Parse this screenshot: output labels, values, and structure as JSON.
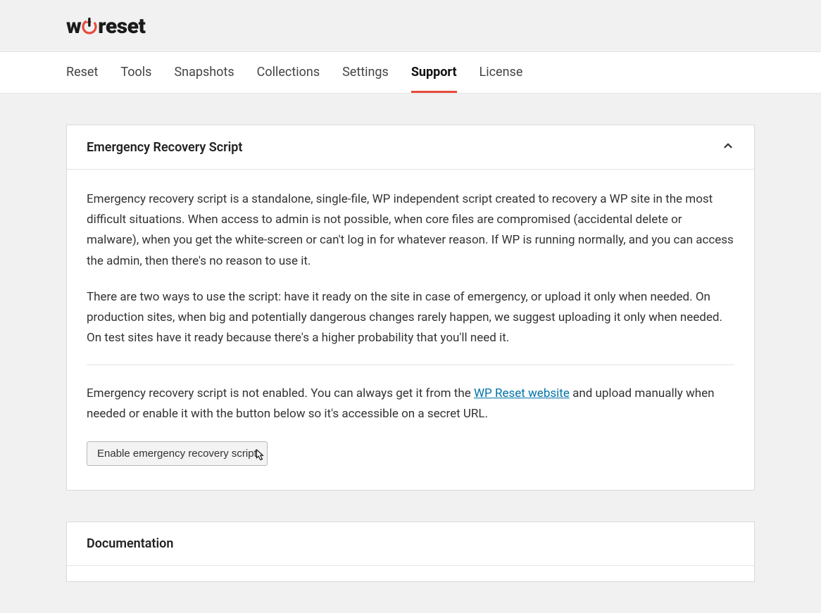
{
  "brand": {
    "prefix": "w",
    "accent": "p",
    "suffix": "reset"
  },
  "tabs": [
    {
      "label": "Reset",
      "active": false
    },
    {
      "label": "Tools",
      "active": false
    },
    {
      "label": "Snapshots",
      "active": false
    },
    {
      "label": "Collections",
      "active": false
    },
    {
      "label": "Settings",
      "active": false
    },
    {
      "label": "Support",
      "active": true
    },
    {
      "label": "License",
      "active": false
    }
  ],
  "panel1": {
    "title": "Emergency Recovery Script",
    "para1": "Emergency recovery script is a standalone, single-file, WP independent script created to recovery a WP site in the most difficult situations. When access to admin is not possible, when core files are compromised (accidental delete or malware), when you get the white-screen or can't log in for whatever reason. If WP is running normally, and you can access the admin, then there's no reason to use it.",
    "para2": "There are two ways to use the script: have it ready on the site in case of emergency, or upload it only when needed. On production sites, when big and potentially dangerous changes rarely happen, we suggest uploading it only when needed. On test sites have it ready because there's a higher probability that you'll need it.",
    "para3a": "Emergency recovery script is not enabled. You can always get it from the ",
    "para3link": "WP Reset website",
    "para3b": " and upload manually when needed or enable it with the button below so it's accessible on a secret URL.",
    "button": "Enable emergency recovery script"
  },
  "panel2": {
    "title": "Documentation"
  }
}
